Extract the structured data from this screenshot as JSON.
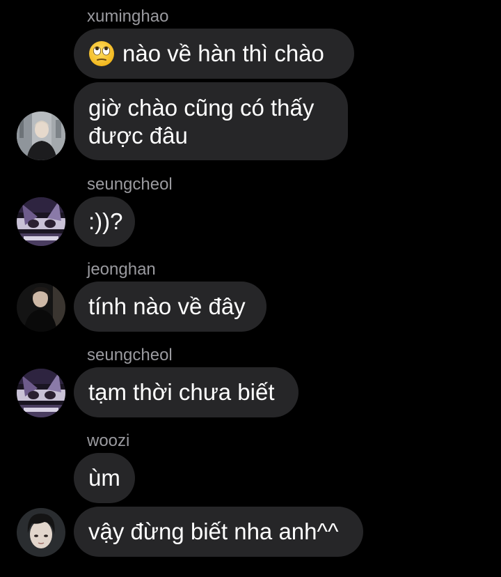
{
  "messages": [
    {
      "sender": "xuminghao",
      "bubbles": [
        {
          "emoji": "face-with-rolling-eyes",
          "text": "nào về hàn thì chào"
        },
        {
          "lines": [
            "giờ chào cũng có thấy",
            "được đâu"
          ]
        }
      ],
      "avatar": "avatar-xuminghao"
    },
    {
      "sender": "seungcheol",
      "bubbles": [
        {
          "text": ":))?"
        }
      ],
      "avatar": "avatar-seungcheol"
    },
    {
      "sender": "jeonghan",
      "bubbles": [
        {
          "text": "tính nào về đây"
        }
      ],
      "avatar": "avatar-jeonghan"
    },
    {
      "sender": "seungcheol",
      "bubbles": [
        {
          "text": "tạm thời chưa biết"
        }
      ],
      "avatar": "avatar-seungcheol"
    },
    {
      "sender": "woozi",
      "bubbles": [
        {
          "text": "ùm"
        },
        {
          "text": "vậy đừng biết nha anh^^"
        }
      ],
      "avatar": "avatar-woozi"
    }
  ],
  "colors": {
    "background": "#000000",
    "bubble": "#262628",
    "sender_text": "#9a9a9f",
    "message_text": "#ffffff"
  }
}
